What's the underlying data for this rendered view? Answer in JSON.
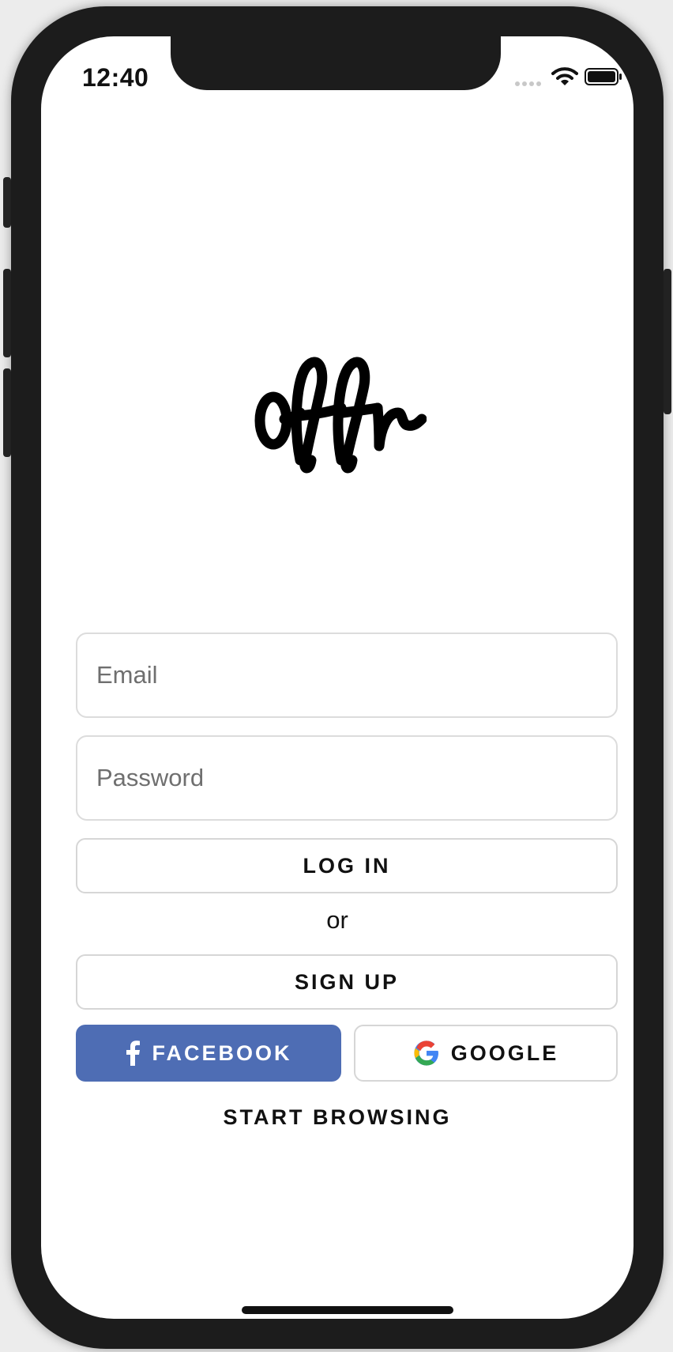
{
  "status_bar": {
    "time": "12:40"
  },
  "login": {
    "email_placeholder": "Email",
    "password_placeholder": "Password",
    "login_label": "LOG IN",
    "or_label": "or",
    "signup_label": "SIGN UP",
    "facebook_label": "FACEBOOK",
    "google_label": "GOOGLE",
    "browse_label": "START BROWSING"
  },
  "brand": {
    "logo_text": "offr"
  },
  "colors": {
    "facebook_blue": "#4e6db4",
    "border_gray": "#d6d6d6",
    "text_dark": "#111111"
  },
  "icons": {
    "facebook": "facebook-f-icon",
    "google": "google-g-icon",
    "wifi": "wifi-icon",
    "battery": "battery-icon"
  }
}
